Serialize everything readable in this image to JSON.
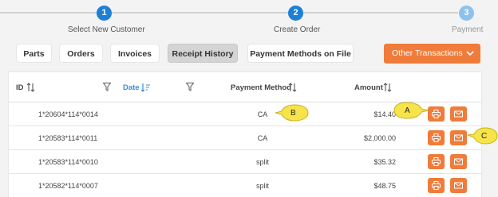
{
  "stepper": {
    "steps": [
      {
        "number": "1",
        "label": "Select New Customer"
      },
      {
        "number": "2",
        "label": "Create Order"
      },
      {
        "number": "3",
        "label": "Payment"
      }
    ]
  },
  "tabs": {
    "items": [
      {
        "label": "Parts"
      },
      {
        "label": "Orders"
      },
      {
        "label": "Invoices"
      },
      {
        "label": "Receipt History"
      },
      {
        "label": "Payment Methods on File"
      }
    ],
    "active": "Receipt History",
    "other_label": "Other Transactions"
  },
  "table": {
    "headers": {
      "id": "ID",
      "date": "Date",
      "payment_method": "Payment Method",
      "amount": "Amount"
    },
    "rows": [
      {
        "id": "1*20604*114*0014",
        "method": "CA",
        "amount": "$14.40"
      },
      {
        "id": "1*20583*114*0011",
        "method": "CA",
        "amount": "$2,000.00"
      },
      {
        "id": "1*20583*114*0010",
        "method": "split",
        "amount": "$35.32"
      },
      {
        "id": "1*20582*114*0007",
        "method": "split",
        "amount": "$48.75"
      }
    ]
  },
  "callouts": {
    "a": "A",
    "b": "B",
    "c": "C"
  },
  "colors": {
    "accent": "#ef7c3a",
    "step_active": "#1d7fd6",
    "step_pending": "#8ec2ee",
    "sort_active": "#3a8ed6",
    "callout_fill": "#f7e34a"
  }
}
